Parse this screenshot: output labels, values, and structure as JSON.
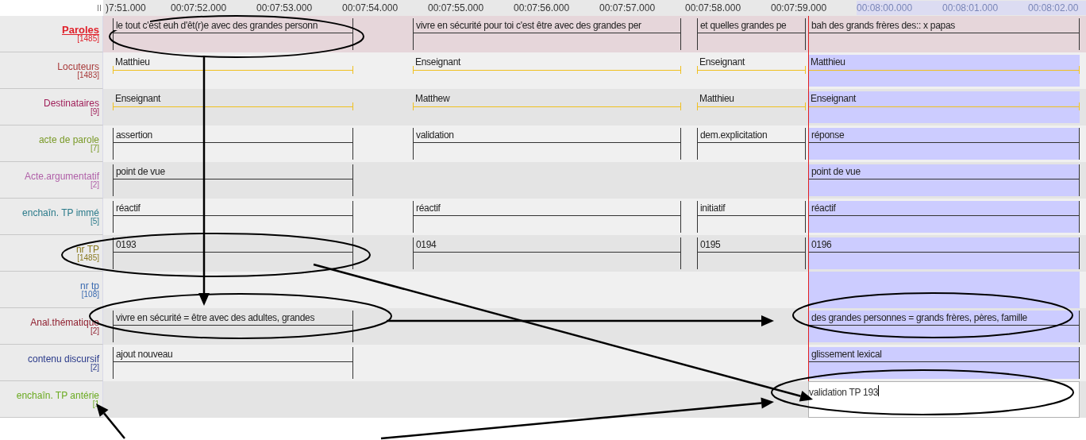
{
  "ruler": {
    "ticks": [
      {
        "text": ")7:51.000",
        "selected": false
      },
      {
        "text": "00:07:52.000",
        "selected": false
      },
      {
        "text": "00:07:53.000",
        "selected": false
      },
      {
        "text": "00:07:54.000",
        "selected": false
      },
      {
        "text": "00:07:55.000",
        "selected": false
      },
      {
        "text": "00:07:56.000",
        "selected": false
      },
      {
        "text": "00:07:57.000",
        "selected": false
      },
      {
        "text": "00:07:58.000",
        "selected": false
      },
      {
        "text": "00:07:59.000",
        "selected": false
      },
      {
        "text": "00:08:00.000",
        "selected": true
      },
      {
        "text": "00:08:01.000",
        "selected": true
      },
      {
        "text": "00:08:02.00",
        "selected": true
      }
    ]
  },
  "tiers": [
    {
      "name": "Paroles",
      "count": "[1485]",
      "color": "#e0202a",
      "selected": true,
      "kind": "aligned",
      "cells": [
        {
          "kind": "annotation",
          "text": "le tout c'est euh d'êt(r)e avec des grandes personn",
          "selected": false
        },
        {
          "kind": "annotation",
          "text": "vivre en sécurité pour toi c'est être avec des grandes per",
          "selected": false
        },
        {
          "kind": "annotation",
          "text": "et quelles grandes pe",
          "selected": false
        },
        {
          "kind": "annotation",
          "text": "bah des grands frères des:: x papas",
          "selected": false
        }
      ]
    },
    {
      "name": "Locuteurs",
      "count": "[1483]",
      "color": "#a83a3a",
      "selected": false,
      "kind": "symbolic",
      "cells": [
        {
          "kind": "annotation",
          "text": "Matthieu",
          "selected": false
        },
        {
          "kind": "annotation",
          "text": "Enseignant",
          "selected": false
        },
        {
          "kind": "annotation",
          "text": "Enseignant",
          "selected": false
        },
        {
          "kind": "annotation",
          "text": "Matthieu",
          "selected": true
        }
      ]
    },
    {
      "name": "Destinataires",
      "count": "[9]",
      "color": "#a0205a",
      "selected": false,
      "kind": "symbolic",
      "cells": [
        {
          "kind": "annotation",
          "text": "Enseignant",
          "selected": false
        },
        {
          "kind": "annotation",
          "text": "Matthew",
          "selected": false
        },
        {
          "kind": "annotation",
          "text": "Matthieu",
          "selected": false
        },
        {
          "kind": "annotation",
          "text": "Enseignant",
          "selected": true
        }
      ]
    },
    {
      "name": "acte de parole",
      "count": "[7]",
      "color": "#7a9a28",
      "selected": false,
      "kind": "aligned",
      "cells": [
        {
          "kind": "annotation",
          "text": "assertion",
          "selected": false
        },
        {
          "kind": "annotation",
          "text": "validation",
          "selected": false
        },
        {
          "kind": "annotation",
          "text": "dem.explicitation",
          "selected": false
        },
        {
          "kind": "annotation",
          "text": "réponse",
          "selected": true
        }
      ]
    },
    {
      "name": "Acte.argumentatif",
      "count": "[2]",
      "color": "#b060a8",
      "selected": false,
      "kind": "aligned",
      "cells": [
        {
          "kind": "annotation",
          "text": "point de vue",
          "selected": false
        },
        {
          "kind": "gap"
        },
        {
          "kind": "gap"
        },
        {
          "kind": "annotation",
          "text": "point de vue",
          "selected": true
        }
      ]
    },
    {
      "name": "enchaîn. TP immé",
      "count": "[5]",
      "color": "#2a7a8a",
      "selected": false,
      "kind": "aligned",
      "cells": [
        {
          "kind": "annotation",
          "text": "réactif",
          "selected": false
        },
        {
          "kind": "annotation",
          "text": "réactif",
          "selected": false
        },
        {
          "kind": "annotation",
          "text": "initiatif",
          "selected": false
        },
        {
          "kind": "annotation",
          "text": "réactif",
          "selected": true
        }
      ]
    },
    {
      "name": "nr TP",
      "count": "[1485]",
      "color": "#8a7a20",
      "selected": false,
      "kind": "aligned",
      "cells": [
        {
          "kind": "annotation",
          "text": "0193",
          "selected": false
        },
        {
          "kind": "annotation",
          "text": "0194",
          "selected": false
        },
        {
          "kind": "annotation",
          "text": "0195",
          "selected": false
        },
        {
          "kind": "annotation",
          "text": "0196",
          "selected": true
        }
      ]
    },
    {
      "name": "nr tp",
      "count": "[108]",
      "color": "#3a6ab0",
      "selected": false,
      "cells": [
        {
          "kind": "gap"
        },
        {
          "kind": "gap"
        },
        {
          "kind": "gap"
        },
        {
          "kind": "gap",
          "selected": true
        }
      ]
    },
    {
      "name": "Anal.thématique",
      "count": "[2]",
      "color": "#902030",
      "selected": false,
      "kind": "aligned",
      "cells": [
        {
          "kind": "annotation",
          "text": "vivre en sécurité = être avec des adultes, grandes",
          "selected": false
        },
        {
          "kind": "gap"
        },
        {
          "kind": "gap"
        },
        {
          "kind": "annotation",
          "text": "des grandes personnes = grands frères, pères, famille",
          "selected": true
        }
      ]
    },
    {
      "name": "contenu discursif",
      "count": "[2]",
      "color": "#2a3a8a",
      "selected": false,
      "kind": "aligned",
      "cells": [
        {
          "kind": "annotation",
          "text": "ajout nouveau",
          "selected": false
        },
        {
          "kind": "gap"
        },
        {
          "kind": "gap"
        },
        {
          "kind": "annotation",
          "text": "glissement lexical",
          "selected": true
        }
      ]
    },
    {
      "name": "enchaîn. TP antérie",
      "count": "[1",
      "color": "#6aaa20",
      "selected": false,
      "cells": [
        {
          "kind": "gap"
        },
        {
          "kind": "gap"
        },
        {
          "kind": "gap"
        },
        {
          "kind": "editor",
          "value": "validation TP 193",
          "selected": false
        }
      ]
    }
  ]
}
